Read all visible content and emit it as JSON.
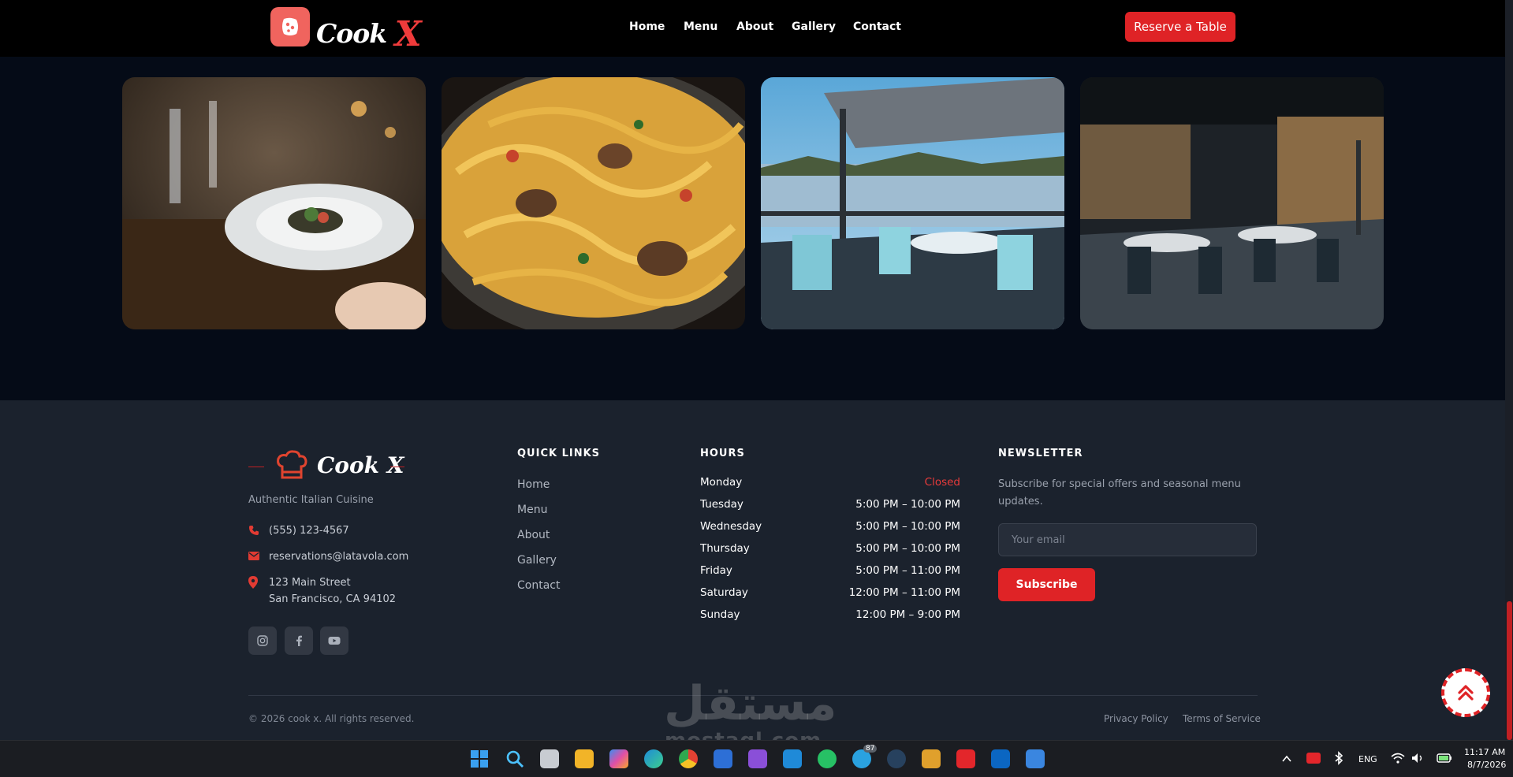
{
  "header": {
    "logo_word": "Cook",
    "logo_x": "X",
    "nav": [
      "Home",
      "Menu",
      "About",
      "Gallery",
      "Contact"
    ],
    "reserve_label": "Reserve a Table"
  },
  "gallery": {
    "images": [
      {
        "name": "plated-dish-photo"
      },
      {
        "name": "pasta-photo"
      },
      {
        "name": "waterfront-terrace-photo"
      },
      {
        "name": "dining-room-photo"
      }
    ]
  },
  "footer": {
    "brand": {
      "word": "Cook",
      "x": "X",
      "tagline": "Authentic Italian Cuisine"
    },
    "contact": {
      "phone": "(555) 123-4567",
      "email": "reservations@latavola.com",
      "address_line1": "123 Main Street",
      "address_line2": "San Francisco, CA 94102"
    },
    "social": [
      "instagram-icon",
      "facebook-icon",
      "youtube-icon"
    ],
    "quick_links": {
      "title": "QUICK LINKS",
      "items": [
        "Home",
        "Menu",
        "About",
        "Gallery",
        "Contact"
      ]
    },
    "hours": {
      "title": "HOURS",
      "rows": [
        {
          "day": "Monday",
          "time": "Closed"
        },
        {
          "day": "Tuesday",
          "time": "5:00 PM – 10:00 PM"
        },
        {
          "day": "Wednesday",
          "time": "5:00 PM – 10:00 PM"
        },
        {
          "day": "Thursday",
          "time": "5:00 PM – 10:00 PM"
        },
        {
          "day": "Friday",
          "time": "5:00 PM – 11:00 PM"
        },
        {
          "day": "Saturday",
          "time": "12:00 PM – 11:00 PM"
        },
        {
          "day": "Sunday",
          "time": "12:00 PM – 9:00 PM"
        }
      ]
    },
    "newsletter": {
      "title": "NEWSLETTER",
      "description_line1": "Subscribe for special offers and seasonal menu",
      "description_line2": "updates.",
      "placeholder": "Your email",
      "button": "Subscribe"
    },
    "copyright": "© 2026 cook x. All rights reserved.",
    "legal": [
      "Privacy Policy",
      "Terms of Service"
    ]
  },
  "watermark": {
    "arabic": "مستقل",
    "latin": "mostaql.com"
  },
  "taskbar": {
    "telegram_badge": "87",
    "language": "ENG",
    "time": "11:17 AM",
    "date": "8/7/2026"
  },
  "colors": {
    "accent": "#df2326",
    "nav_bg": "#000000",
    "gallery_bg": "#050b17",
    "footer_bg": "#1b222d"
  }
}
